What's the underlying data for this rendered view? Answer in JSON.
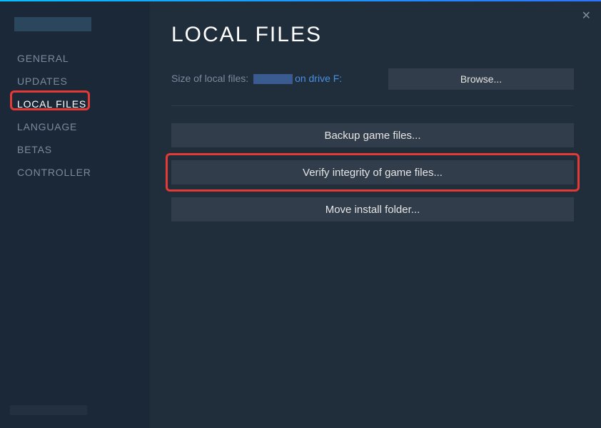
{
  "sidebar": {
    "items": [
      {
        "label": "GENERAL"
      },
      {
        "label": "UPDATES"
      },
      {
        "label": "LOCAL FILES"
      },
      {
        "label": "LANGUAGE"
      },
      {
        "label": "BETAS"
      },
      {
        "label": "CONTROLLER"
      }
    ]
  },
  "main": {
    "title": "LOCAL FILES",
    "size_label": "Size of local files: ",
    "drive_text": "on drive F:",
    "browse_label": "Browse...",
    "backup_label": "Backup game files...",
    "verify_label": "Verify integrity of game files...",
    "move_label": "Move install folder..."
  }
}
